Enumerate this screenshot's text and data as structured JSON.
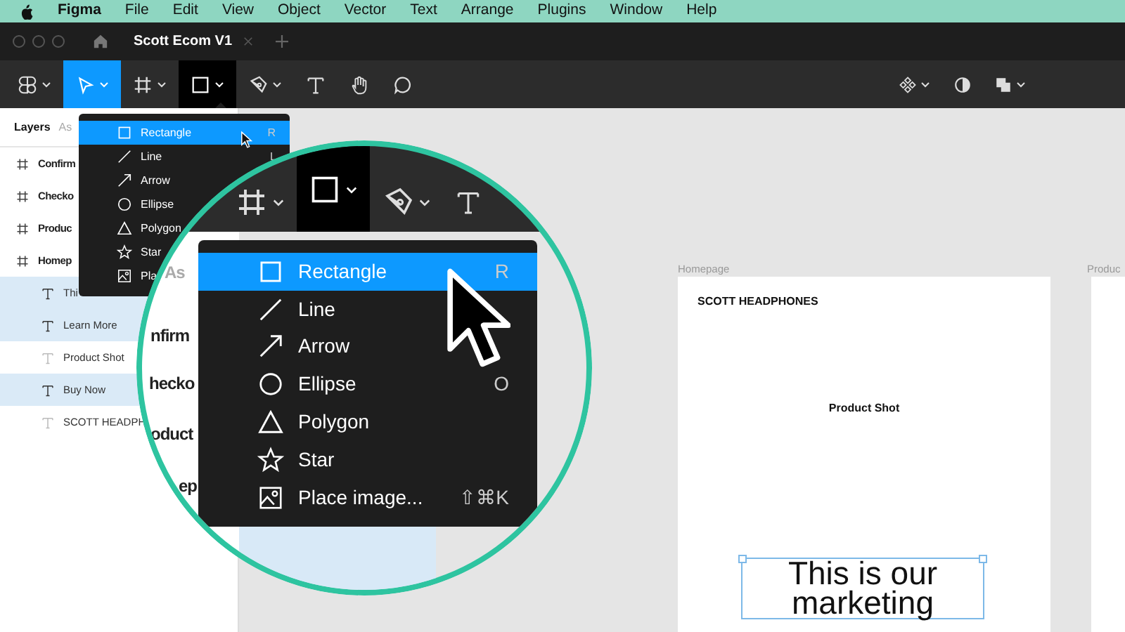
{
  "menu_bar": {
    "items": [
      {
        "label": "Figma",
        "kind": "app"
      },
      {
        "label": "File",
        "kind": "menu"
      },
      {
        "label": "Edit",
        "kind": "menu"
      },
      {
        "label": "View",
        "kind": "menu"
      },
      {
        "label": "Object",
        "kind": "menu"
      },
      {
        "label": "Vector",
        "kind": "menu"
      },
      {
        "label": "Text",
        "kind": "menu"
      },
      {
        "label": "Arrange",
        "kind": "menu"
      },
      {
        "label": "Plugins",
        "kind": "menu"
      },
      {
        "label": "Window",
        "kind": "menu"
      },
      {
        "label": "Help",
        "kind": "menu"
      }
    ]
  },
  "tab_bar": {
    "tabs": [
      {
        "label": "Scott Ecom V1",
        "selected": true
      }
    ]
  },
  "toolbar": {
    "tools": [
      {
        "kind": "main-menu",
        "selected": false,
        "menu_open": false
      },
      {
        "kind": "move",
        "selected": true,
        "menu_open": false
      },
      {
        "kind": "frame",
        "selected": false,
        "menu_open": false
      },
      {
        "kind": "rectangle",
        "selected": false,
        "menu_open": true
      },
      {
        "kind": "pen",
        "selected": false,
        "menu_open": false
      },
      {
        "kind": "text",
        "selected": false,
        "menu_open": false
      },
      {
        "kind": "hand",
        "selected": false,
        "menu_open": false
      },
      {
        "kind": "comment",
        "selected": false,
        "menu_open": false
      }
    ],
    "right_tools": [
      {
        "kind": "component"
      },
      {
        "kind": "contrast"
      },
      {
        "kind": "boolean"
      }
    ]
  },
  "layers_panel": {
    "tabs": [
      {
        "label": "Layers",
        "selected": true
      },
      {
        "label": "As",
        "selected": false
      }
    ],
    "layers": [
      {
        "kind": "frame",
        "name": "Confirm",
        "selected": false
      },
      {
        "kind": "frame",
        "name": "Checko",
        "selected": false
      },
      {
        "kind": "frame",
        "name": "Produc",
        "selected": false
      },
      {
        "kind": "frame",
        "name": "Homep",
        "selected": false,
        "children": [
          {
            "kind": "text",
            "name": "Thi",
            "selected": true
          },
          {
            "kind": "text",
            "name": "Learn More",
            "selected": true
          },
          {
            "kind": "text",
            "name": "Product Shot",
            "selected": false
          },
          {
            "kind": "text",
            "name": "Buy Now",
            "selected": true
          },
          {
            "kind": "text",
            "name": "SCOTT HEADPH",
            "selected": false
          }
        ]
      }
    ]
  },
  "shape_menu": {
    "items": [
      {
        "kind": "rectangle",
        "label": "Rectangle",
        "shortcut": "R",
        "selected": true
      },
      {
        "kind": "line",
        "label": "Line",
        "shortcut": "L",
        "selected": false
      },
      {
        "kind": "arrow",
        "label": "Arrow",
        "selected": false
      },
      {
        "kind": "ellipse",
        "label": "Ellipse",
        "selected": false
      },
      {
        "kind": "polygon",
        "label": "Polygon",
        "selected": false
      },
      {
        "kind": "star",
        "label": "Star",
        "selected": false
      },
      {
        "kind": "image",
        "label": "Pla",
        "selected": false
      }
    ]
  },
  "canvas": {
    "frames": [
      {
        "label": "Homepage",
        "brand": "SCOTT HEADPHONES",
        "image_label": "Product Shot",
        "headline": "This is our marketing"
      },
      {
        "label": "Produc"
      }
    ]
  },
  "magnifier": {
    "toolbar_tools": [
      {
        "kind": "frame",
        "menu_open": false
      },
      {
        "kind": "rectangle",
        "menu_open": true
      },
      {
        "kind": "pen",
        "menu_open": false
      },
      {
        "kind": "text",
        "menu_open": false
      }
    ],
    "layer_fragments": [
      "As",
      "nfirm",
      "hecko",
      "oduct",
      "ep"
    ],
    "shape_menu": {
      "items": [
        {
          "kind": "rectangle",
          "label": "Rectangle",
          "shortcut": "R",
          "selected": true
        },
        {
          "kind": "line",
          "label": "Line",
          "selected": false
        },
        {
          "kind": "arrow",
          "label": "Arrow",
          "selected": false
        },
        {
          "kind": "ellipse",
          "label": "Ellipse",
          "shortcut": "O",
          "selected": false
        },
        {
          "kind": "polygon",
          "label": "Polygon",
          "selected": false
        },
        {
          "kind": "star",
          "label": "Star",
          "selected": false
        },
        {
          "kind": "image",
          "label": "Place image...",
          "shortcut": "⇧⌘K",
          "selected": false
        }
      ]
    }
  }
}
